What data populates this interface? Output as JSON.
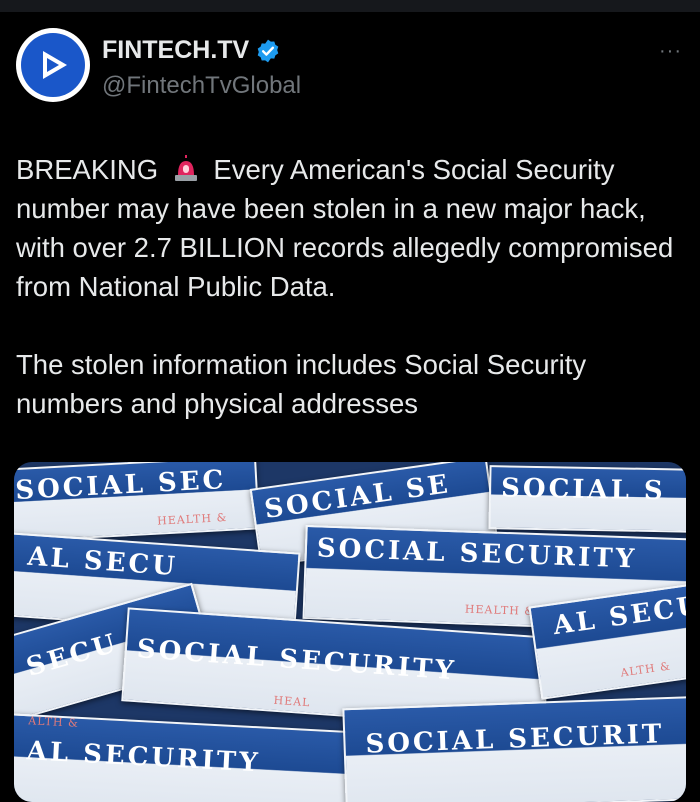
{
  "account": {
    "display_name": "FINTECH.TV",
    "handle": "@FintechTvGlobal",
    "verified_icon": "verified-badge-icon",
    "more_label": "···"
  },
  "tweet": {
    "line1_pre": "BREAKING ",
    "line1_post": " Every American's Social Security number may have been stolen in a new major hack, with over 2.7 BILLION records allegedly compromised from National Public Data.",
    "paragraph2": "The stolen information includes Social Security numbers and physical addresses"
  },
  "image": {
    "card_texts": [
      "SOCIAL SEC",
      "SOCIAL SE",
      "SOCIAL S",
      "AL SECU",
      "SOCIAL SECURITY",
      "SECU",
      "SOCIAL SECURITY",
      "AL SECU",
      "AL SECURITY",
      "SOCIAL SECURIT"
    ],
    "seal_texts": [
      "HEALTH &",
      "HEALTH &",
      "ALTH &",
      "ALTH &",
      "HEAL"
    ]
  },
  "colors": {
    "accent": "#1d9bf0",
    "bg": "#000000",
    "text": "#e7e9ea",
    "muted": "#71767b"
  }
}
